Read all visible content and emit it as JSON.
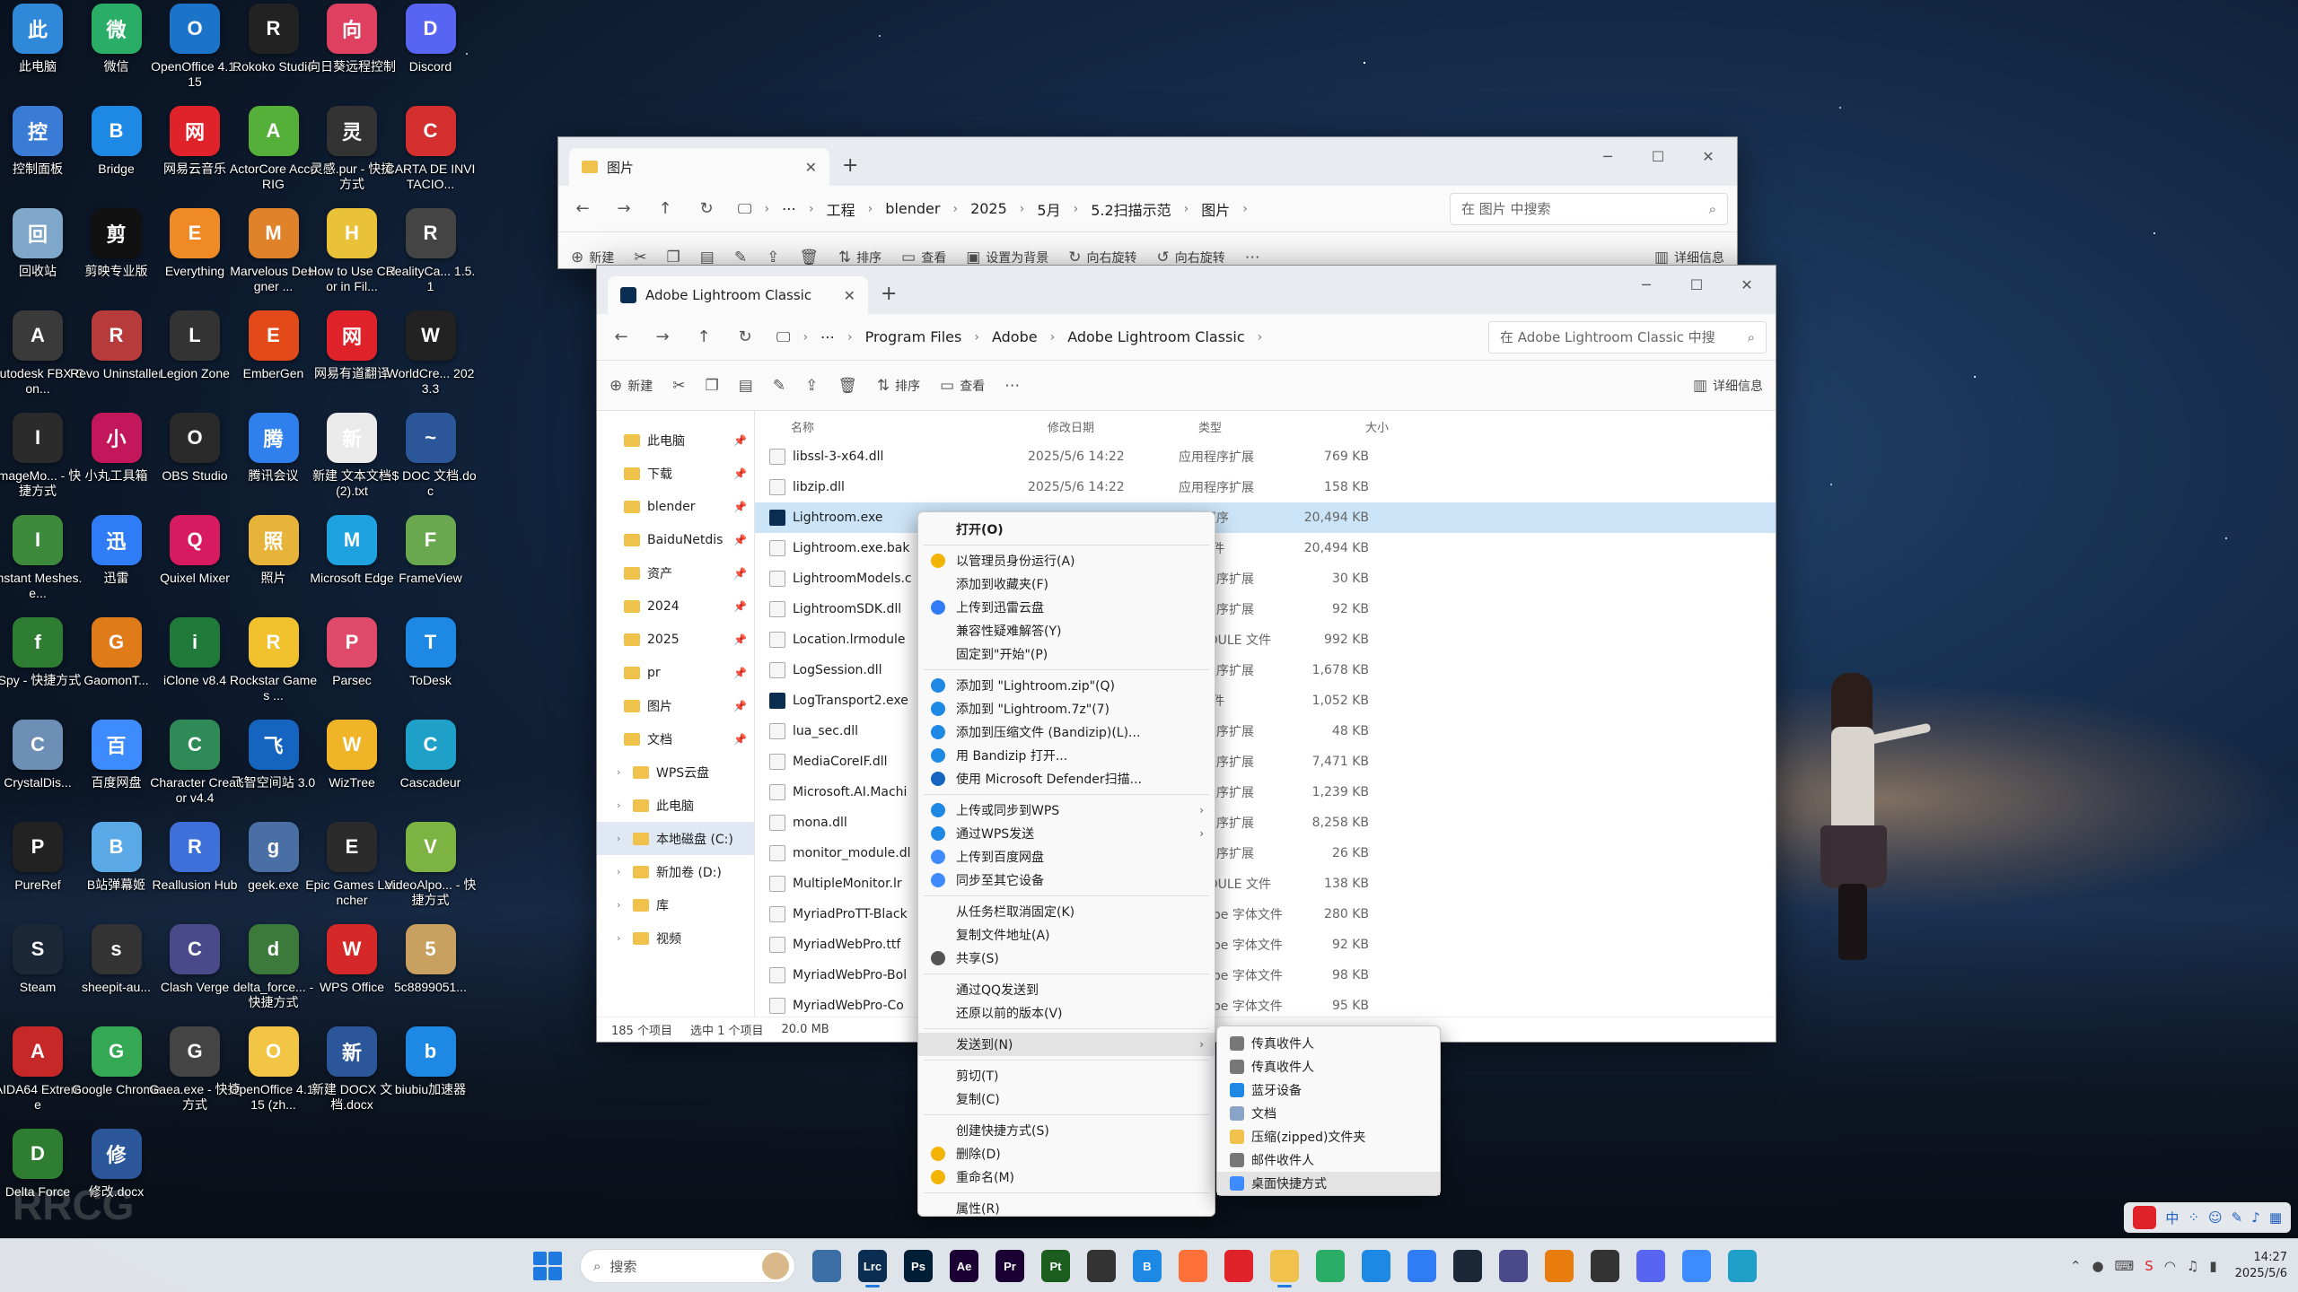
{
  "desktop_icons": [
    {
      "label": "此电脑",
      "color": "#2f88d8"
    },
    {
      "label": "微信",
      "color": "#2aae67"
    },
    {
      "label": "OpenOffice 4.1.15",
      "color": "#1b74c9"
    },
    {
      "label": "Rokoko Studio",
      "color": "#222222"
    },
    {
      "label": "向日葵远程控制",
      "color": "#e0405f"
    },
    {
      "label": "Discord",
      "color": "#5865f2"
    },
    {
      "label": "控制面板",
      "color": "#3a7bd5"
    },
    {
      "label": "Bridge",
      "color": "#1e88e5"
    },
    {
      "label": "网易云音乐",
      "color": "#e0232b"
    },
    {
      "label": "ActorCore AccuRIG",
      "color": "#55b03a"
    },
    {
      "label": "灵感.pur - 快捷方式",
      "color": "#333333"
    },
    {
      "label": "CARTA DE INVITACIO...",
      "color": "#d32f2f"
    },
    {
      "label": "回收站",
      "color": "#7ea7c9"
    },
    {
      "label": "剪映专业版",
      "color": "#111111"
    },
    {
      "label": "Everything",
      "color": "#f08a24"
    },
    {
      "label": "Marvelous Designer ...",
      "color": "#e0822a"
    },
    {
      "label": "How to Use Color in Fil...",
      "color": "#e9c23a"
    },
    {
      "label": "RealityCa... 1.5.1",
      "color": "#444444"
    },
    {
      "label": "Autodesk FBX Con...",
      "color": "#3a3a3a"
    },
    {
      "label": "Revo Uninstaller",
      "color": "#b83b3b"
    },
    {
      "label": "Legion Zone",
      "color": "#333333"
    },
    {
      "label": "EmberGen",
      "color": "#e24a1a"
    },
    {
      "label": "网易有道翻译",
      "color": "#e0232b"
    },
    {
      "label": "WorldCre... 2023.3",
      "color": "#222222"
    },
    {
      "label": "ImageMo... - 快捷方式",
      "color": "#2b2b2b"
    },
    {
      "label": "小丸工具箱",
      "color": "#c2185b"
    },
    {
      "label": "OBS Studio",
      "color": "#2a2a2a"
    },
    {
      "label": "腾讯会议",
      "color": "#2f80ed"
    },
    {
      "label": "新建 文本文档 (2).txt",
      "color": "#eaeaea"
    },
    {
      "label": "~$ DOC 文档.doc",
      "color": "#2b579a"
    },
    {
      "label": "Instant Meshes.e...",
      "color": "#3d8a3d"
    },
    {
      "label": "迅雷",
      "color": "#2f7cf6"
    },
    {
      "label": "Quixel Mixer",
      "color": "#d81b60"
    },
    {
      "label": "照片",
      "color": "#e8b339"
    },
    {
      "label": "Microsoft Edge",
      "color": "#1fa2e0"
    },
    {
      "label": "FrameView",
      "color": "#6aa84f"
    },
    {
      "label": "fSpy - 快捷方式",
      "color": "#2e7d32"
    },
    {
      "label": "GaomonT...",
      "color": "#e07b1a"
    },
    {
      "label": "iClone v8.4",
      "color": "#1f7a3a"
    },
    {
      "label": "Rockstar Games ...",
      "color": "#f2c12e"
    },
    {
      "label": "Parsec",
      "color": "#e04a6a"
    },
    {
      "label": "ToDesk",
      "color": "#1e88e5"
    },
    {
      "label": "CrystalDis...",
      "color": "#6d8fb5"
    },
    {
      "label": "百度网盘",
      "color": "#3d8bff"
    },
    {
      "label": "Character Creator v4.4",
      "color": "#2e8b57"
    },
    {
      "label": "飞智空间站 3.0",
      "color": "#1565c0"
    },
    {
      "label": "WizTree",
      "color": "#f0b429"
    },
    {
      "label": "Cascadeur",
      "color": "#1fa0c8"
    },
    {
      "label": "PureRef",
      "color": "#222222"
    },
    {
      "label": "B站弹幕姬",
      "color": "#5aa9e6"
    },
    {
      "label": "Reallusion Hub",
      "color": "#3f6fd8"
    },
    {
      "label": "geek.exe",
      "color": "#4a6fa5"
    },
    {
      "label": "Epic Games Launcher",
      "color": "#2b2b2b"
    },
    {
      "label": "VideoAlpo... - 快捷方式",
      "color": "#7cb342"
    },
    {
      "label": "Steam",
      "color": "#1b2838"
    },
    {
      "label": "sheepit-au...",
      "color": "#333333"
    },
    {
      "label": "Clash Verge",
      "color": "#4a4a8a"
    },
    {
      "label": "delta_force... - 快捷方式",
      "color": "#3b7a3b"
    },
    {
      "label": "WPS Office",
      "color": "#d62828"
    },
    {
      "label": "5c8899051...",
      "color": "#c8a060"
    },
    {
      "label": "AIDA64 Extreme",
      "color": "#c62828"
    },
    {
      "label": "Google Chrome",
      "color": "#34a853"
    },
    {
      "label": "Gaea.exe - 快捷方式",
      "color": "#444444"
    },
    {
      "label": "OpenOffice 4.1.15 (zh...",
      "color": "#f3c545"
    },
    {
      "label": "新建 DOCX 文档.docx",
      "color": "#2b579a"
    },
    {
      "label": "biubiu加速器",
      "color": "#1e88e5"
    },
    {
      "label": "Delta Force",
      "color": "#2e7d32"
    },
    {
      "label": "修改.docx",
      "color": "#2b579a"
    }
  ],
  "back_window": {
    "tab_title": "图片",
    "breadcrumbs": [
      "工程",
      "blender",
      "2025",
      "5月",
      "5.2扫描示范",
      "图片"
    ],
    "search_placeholder": "在 图片 中搜索",
    "toolbar": {
      "new": "新建",
      "sort": "排序",
      "view": "查看",
      "set_bg": "设置为背景",
      "rotate_right": "向右旋转",
      "rotate_left": "向右旋转",
      "details": "详细信息"
    }
  },
  "front_window": {
    "tab_title": "Adobe Lightroom Classic",
    "breadcrumbs": [
      "Program Files",
      "Adobe",
      "Adobe Lightroom Classic"
    ],
    "search_placeholder": "在 Adobe Lightroom Classic 中搜",
    "toolbar": {
      "new": "新建",
      "sort": "排序",
      "view": "查看",
      "details": "详细信息"
    },
    "nav": [
      {
        "label": "此电脑",
        "pinned": true
      },
      {
        "label": "下载",
        "pinned": true
      },
      {
        "label": "blender",
        "pinned": true
      },
      {
        "label": "BaiduNetdis",
        "pinned": true
      },
      {
        "label": "资产",
        "pinned": true
      },
      {
        "label": "2024",
        "pinned": true
      },
      {
        "label": "2025",
        "pinned": true
      },
      {
        "label": "pr",
        "pinned": true
      },
      {
        "label": "图片",
        "pinned": true
      },
      {
        "label": "文档",
        "pinned": true
      },
      {
        "label": "WPS云盘",
        "pinned": false
      },
      {
        "label": "此电脑",
        "pinned": false
      },
      {
        "label": "本地磁盘 (C:)",
        "pinned": false
      },
      {
        "label": "新加卷 (D:)",
        "pinned": false
      },
      {
        "label": "库",
        "pinned": false
      },
      {
        "label": "视频",
        "pinned": false
      }
    ],
    "columns": {
      "name": "名称",
      "date": "修改日期",
      "type": "类型",
      "size": "大小"
    },
    "files": [
      {
        "name": "libssl-3-x64.dll",
        "date": "2025/5/6 14:22",
        "type": "应用程序扩展",
        "size": "769 KB"
      },
      {
        "name": "libzip.dll",
        "date": "2025/5/6 14:22",
        "type": "应用程序扩展",
        "size": "158 KB"
      },
      {
        "name": "Lightroom.exe",
        "date": "2025/5/6 14:22",
        "type": "应用程序",
        "size": "20,494 KB"
      },
      {
        "name": "Lightroom.exe.bak",
        "date": "",
        "type": "AK 文件",
        "size": "20,494 KB"
      },
      {
        "name": "LightroomModels.c",
        "date": "",
        "type": "应用程序扩展",
        "size": "30 KB"
      },
      {
        "name": "LightroomSDK.dll",
        "date": "",
        "type": "应用程序扩展",
        "size": "92 KB"
      },
      {
        "name": "Location.lrmodule",
        "date": "",
        "type": "RMODULE 文件",
        "size": "992 KB"
      },
      {
        "name": "LogSession.dll",
        "date": "",
        "type": "应用程序扩展",
        "size": "1,678 KB"
      },
      {
        "name": "LogTransport2.exe",
        "date": "",
        "type": "AK 文件",
        "size": "1,052 KB"
      },
      {
        "name": "lua_sec.dll",
        "date": "",
        "type": "应用程序扩展",
        "size": "48 KB"
      },
      {
        "name": "MediaCoreIF.dll",
        "date": "",
        "type": "应用程序扩展",
        "size": "7,471 KB"
      },
      {
        "name": "Microsoft.AI.Machi",
        "date": "",
        "type": "应用程序扩展",
        "size": "1,239 KB"
      },
      {
        "name": "mona.dll",
        "date": "",
        "type": "应用程序扩展",
        "size": "8,258 KB"
      },
      {
        "name": "monitor_module.dl",
        "date": "",
        "type": "应用程序扩展",
        "size": "26 KB"
      },
      {
        "name": "MultipleMonitor.lr",
        "date": "",
        "type": "RMODULE 文件",
        "size": "138 KB"
      },
      {
        "name": "MyriadProTT-Black",
        "date": "",
        "type": "rueType 字体文件",
        "size": "280 KB"
      },
      {
        "name": "MyriadWebPro.ttf",
        "date": "",
        "type": "rueType 字体文件",
        "size": "92 KB"
      },
      {
        "name": "MyriadWebPro-Bol",
        "date": "",
        "type": "rueType 字体文件",
        "size": "98 KB"
      },
      {
        "name": "MyriadWebPro-Co",
        "date": "",
        "type": "rueType 字体文件",
        "size": "95 KB"
      }
    ],
    "status": {
      "count": "185 个项目",
      "selected": "选中 1 个项目",
      "size": "20.0 MB"
    }
  },
  "context_menu": {
    "items": [
      {
        "label": "打开(O)",
        "icon_color": "",
        "bold": true
      },
      {
        "label": "以管理员身份运行(A)",
        "icon_color": "#f2b400"
      },
      {
        "label": "添加到收藏夹(F)",
        "icon_color": ""
      },
      {
        "label": "上传到迅雷云盘",
        "icon_color": "#2f7cf6"
      },
      {
        "label": "兼容性疑难解答(Y)",
        "icon_color": ""
      },
      {
        "label": "固定到\"开始\"(P)",
        "icon_color": ""
      },
      {
        "label": "添加到 \"Lightroom.zip\"(Q)",
        "icon_color": "#1e88e5"
      },
      {
        "label": "添加到 \"Lightroom.7z\"(7)",
        "icon_color": "#1e88e5"
      },
      {
        "label": "添加到压缩文件 (Bandizip)(L)...",
        "icon_color": "#1e88e5"
      },
      {
        "label": "用 Bandizip 打开...",
        "icon_color": "#1e88e5"
      },
      {
        "label": "使用 Microsoft Defender扫描...",
        "icon_color": "#1565c0"
      },
      {
        "label": "上传或同步到WPS",
        "icon_color": "#1e88e5",
        "submenu": true
      },
      {
        "label": "通过WPS发送",
        "icon_color": "#1e88e5",
        "submenu": true
      },
      {
        "label": "上传到百度网盘",
        "icon_color": "#3d8bff"
      },
      {
        "label": "同步至其它设备",
        "icon_color": "#3d8bff"
      },
      {
        "label": "从任务栏取消固定(K)",
        "icon_color": ""
      },
      {
        "label": "复制文件地址(A)",
        "icon_color": ""
      },
      {
        "label": "共享(S)",
        "icon_color": "#555555"
      },
      {
        "label": "通过QQ发送到",
        "icon_color": ""
      },
      {
        "label": "还原以前的版本(V)",
        "icon_color": ""
      },
      {
        "label": "发送到(N)",
        "icon_color": "",
        "submenu": true,
        "highlight": true
      },
      {
        "label": "剪切(T)",
        "icon_color": ""
      },
      {
        "label": "复制(C)",
        "icon_color": ""
      },
      {
        "label": "创建快捷方式(S)",
        "icon_color": ""
      },
      {
        "label": "删除(D)",
        "icon_color": "#f2b400"
      },
      {
        "label": "重命名(M)",
        "icon_color": "#f2b400"
      },
      {
        "label": "属性(R)",
        "icon_color": ""
      }
    ],
    "send_to": [
      {
        "label": "传真收件人",
        "icon_color": "#777777"
      },
      {
        "label": "传真收件人",
        "icon_color": "#777777"
      },
      {
        "label": "蓝牙设备",
        "icon_color": "#1e88e5"
      },
      {
        "label": "文档",
        "icon_color": "#8aa4c8"
      },
      {
        "label": "压缩(zipped)文件夹",
        "icon_color": "#f1c24b"
      },
      {
        "label": "邮件收件人",
        "icon_color": "#777777"
      },
      {
        "label": "桌面快捷方式",
        "icon_color": "#3d8bff"
      }
    ]
  },
  "taskbar": {
    "search_placeholder": "搜索",
    "apps": [
      {
        "name": "task-view",
        "label": "",
        "color": "#3a6ea5"
      },
      {
        "name": "lightroom-classic",
        "label": "Lrc",
        "color": "#0b2d52",
        "active": true
      },
      {
        "name": "photoshop",
        "label": "Ps",
        "color": "#001e36"
      },
      {
        "name": "after-effects",
        "label": "Ae",
        "color": "#1a0033"
      },
      {
        "name": "premiere",
        "label": "Pr",
        "color": "#1a0033"
      },
      {
        "name": "pycharm",
        "label": "Pt",
        "color": "#1b5e20"
      },
      {
        "name": "davinci",
        "label": "",
        "color": "#333333"
      },
      {
        "name": "bridge",
        "label": "B",
        "color": "#1e88e5"
      },
      {
        "name": "firefox",
        "label": "",
        "color": "#ff7139"
      },
      {
        "name": "netease-music",
        "label": "",
        "color": "#e0232b"
      },
      {
        "name": "file-explorer",
        "label": "",
        "color": "#f1c24b",
        "active": true
      },
      {
        "name": "wechat",
        "label": "",
        "color": "#2aae67"
      },
      {
        "name": "app-blue",
        "label": "",
        "color": "#1e88e5"
      },
      {
        "name": "xunlei",
        "label": "",
        "color": "#2f7cf6"
      },
      {
        "name": "steam",
        "label": "",
        "color": "#1b2838"
      },
      {
        "name": "clash",
        "label": "",
        "color": "#4a4a8a"
      },
      {
        "name": "blender",
        "label": "",
        "color": "#e87d0d"
      },
      {
        "name": "chat",
        "label": "",
        "color": "#333333"
      },
      {
        "name": "discord",
        "label": "",
        "color": "#5865f2"
      },
      {
        "name": "baidu-netdisk",
        "label": "",
        "color": "#3d8bff"
      },
      {
        "name": "edit-app",
        "label": "",
        "color": "#1fa0c8"
      }
    ],
    "tray": {
      "ime": "中",
      "time": "14:27",
      "date": "2025/5/6"
    }
  },
  "watermark": "RRCG",
  "accent": "#1e7ae0"
}
